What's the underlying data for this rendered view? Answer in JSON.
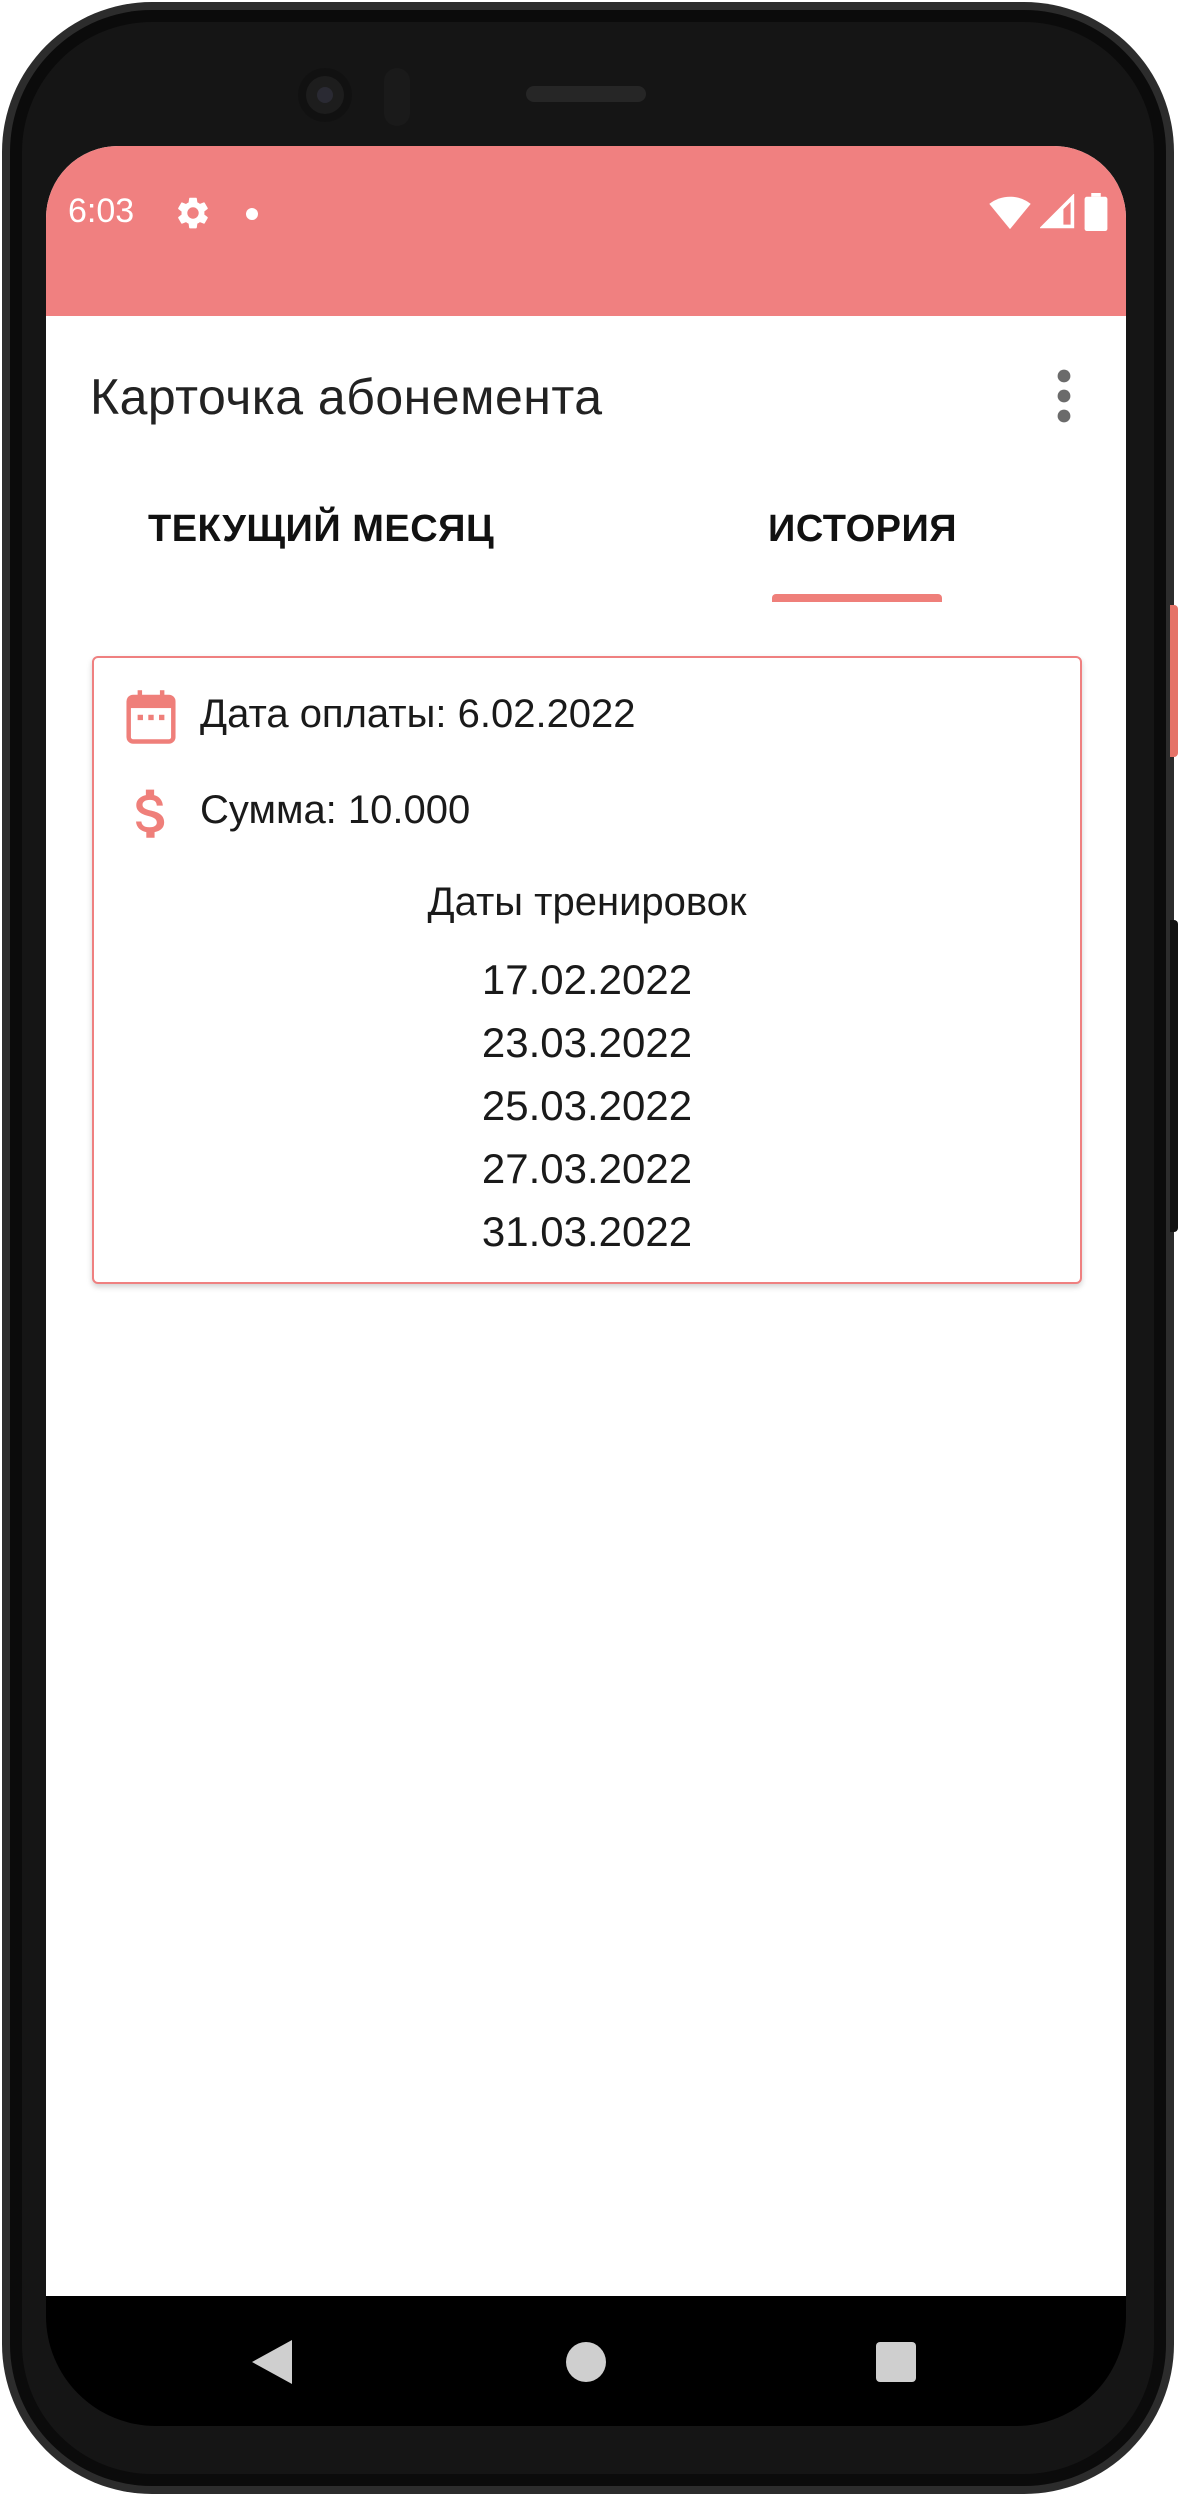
{
  "status_bar": {
    "time": "6:03",
    "icons": [
      "gear-icon",
      "notification-dot-icon",
      "wifi-icon",
      "cellular-signal-icon",
      "battery-icon"
    ],
    "background_color": "#f08080"
  },
  "app_bar": {
    "title": "Карточка абонемента",
    "menu_icon": "overflow-menu-icon"
  },
  "tabs": [
    {
      "label": "ТЕКУЩИЙ МЕСЯЦ",
      "selected": false
    },
    {
      "label": "ИСТОРИЯ",
      "selected": true
    }
  ],
  "card": {
    "payment_date": "Дата оплаты: 6.02.2022",
    "payment_icon": "calendar-icon",
    "sum": "Сумма: 10.000",
    "sum_icon": "dollar-icon",
    "dates_heading": "Даты тренировок",
    "dates": [
      "17.02.2022",
      "23.03.2022",
      "25.03.2022",
      "27.03.2022",
      "31.03.2022"
    ]
  },
  "nav_bar": {
    "buttons": [
      "back-icon",
      "home-icon",
      "recents-icon"
    ]
  },
  "colors": {
    "accent": "#ef7f7a",
    "status_bar": "#f08080"
  }
}
